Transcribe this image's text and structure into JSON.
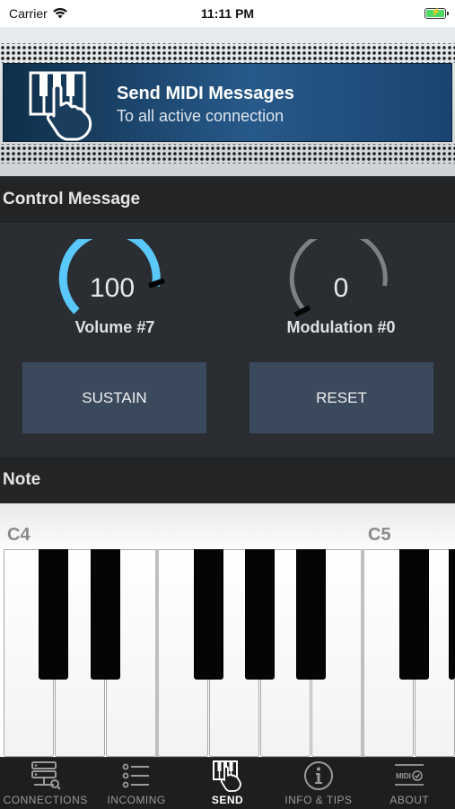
{
  "status": {
    "carrier": "Carrier",
    "time": "11:11 PM"
  },
  "banner": {
    "title": "Send MIDI Messages",
    "subtitle": "To all active connection"
  },
  "control_section": {
    "title": "Control Message",
    "knobs": [
      {
        "value": "100",
        "label": "Volume #7",
        "level": 1.0,
        "color": "#5ac8fa"
      },
      {
        "value": "0",
        "label": "Modulation #0",
        "level": 0.0,
        "color": "#5ac8fa"
      }
    ],
    "buttons": {
      "sustain": "SUSTAIN",
      "reset": "RESET"
    }
  },
  "note_section": {
    "title": "Note",
    "octave_labels": [
      "C4",
      "C5"
    ]
  },
  "tabs": [
    {
      "label": "CONNECTIONS",
      "icon": "connections-icon",
      "active": false
    },
    {
      "label": "INCOMING",
      "icon": "incoming-list-icon",
      "active": false
    },
    {
      "label": "SEND",
      "icon": "send-keyboard-icon",
      "active": true
    },
    {
      "label": "INFO & TIPS",
      "icon": "info-icon",
      "active": false
    },
    {
      "label": "ABOUT",
      "icon": "about-midi-icon",
      "active": false
    }
  ],
  "tab_midi_badge": "MIDI",
  "colors": {
    "accent": "#5ac8fa",
    "button_bg": "#3a4a5c",
    "banner_bg": "#27598a"
  }
}
